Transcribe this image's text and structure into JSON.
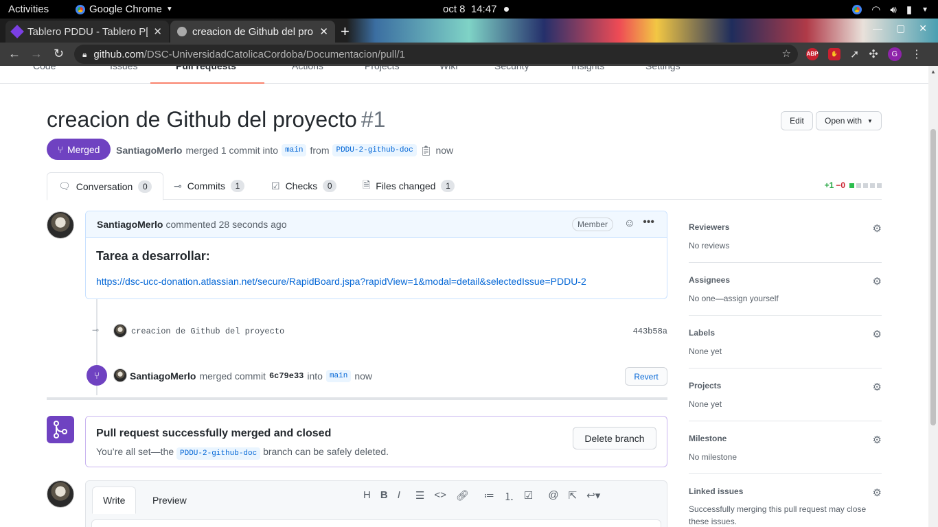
{
  "os": {
    "activities": "Activities",
    "app": "Google Chrome",
    "date": "oct 8",
    "time": "14:47"
  },
  "browser": {
    "tabs": [
      {
        "title": "Tablero PDDU - Tablero P[",
        "active": false
      },
      {
        "title": "creacion de Github del pro",
        "active": true
      }
    ],
    "url_host": "github.com",
    "url_path": "/DSC-UniversidadCatolicaCordoba/Documentacion/pull/1",
    "ext_abp": "ABP",
    "profile_initial": "G"
  },
  "reponav": {
    "items": [
      "Code",
      "Issues",
      "Pull requests",
      "Actions",
      "Projects",
      "Wiki",
      "Security",
      "Insights",
      "Settings"
    ]
  },
  "pr": {
    "title": "creacion de Github del proyecto",
    "number": "#1",
    "edit_label": "Edit",
    "open_with_label": "Open with",
    "state": "Merged",
    "author": "SantiagoMerlo",
    "merge_text": "merged 1 commit into",
    "base_branch": "main",
    "from_text": "from",
    "head_branch": "PDDU-2-github-doc",
    "time": "now"
  },
  "prtabs": [
    {
      "label": "Conversation",
      "count": "0"
    },
    {
      "label": "Commits",
      "count": "1"
    },
    {
      "label": "Checks",
      "count": "0"
    },
    {
      "label": "Files changed",
      "count": "1"
    }
  ],
  "diffstat": {
    "add": "+1",
    "del": "−0"
  },
  "comment": {
    "author": "SantiagoMerlo",
    "action": "commented",
    "time": "28 seconds ago",
    "role": "Member",
    "heading": "Tarea a desarrollar:",
    "link": "https://dsc-ucc-donation.atlassian.net/secure/RapidBoard.jspa?rapidView=1&modal=detail&selectedIssue=PDDU-2"
  },
  "commit": {
    "message": "creacion de Github del proyecto",
    "sha": "443b58a"
  },
  "merge_event": {
    "author": "SantiagoMerlo",
    "text": "merged commit",
    "sha": "6c79e33",
    "into": "into",
    "branch": "main",
    "time": "now",
    "revert_label": "Revert"
  },
  "merge_box": {
    "title": "Pull request successfully merged and closed",
    "text_pre": "You’re all set—the",
    "branch": "PDDU-2-github-doc",
    "text_post": "branch can be safely deleted.",
    "delete_label": "Delete branch"
  },
  "write": {
    "write_tab": "Write",
    "preview_tab": "Preview"
  },
  "sidebar": [
    {
      "heading": "Reviewers",
      "value": "No reviews"
    },
    {
      "heading": "Assignees",
      "value": "No one—assign yourself"
    },
    {
      "heading": "Labels",
      "value": "None yet"
    },
    {
      "heading": "Projects",
      "value": "None yet"
    },
    {
      "heading": "Milestone",
      "value": "No milestone"
    },
    {
      "heading": "Linked issues",
      "value": "Successfully merging this pull request may close these issues."
    }
  ],
  "colors": {
    "merged": "#6f42c1",
    "link": "#0366d6",
    "add": "#28a745",
    "del": "#cb2431"
  }
}
